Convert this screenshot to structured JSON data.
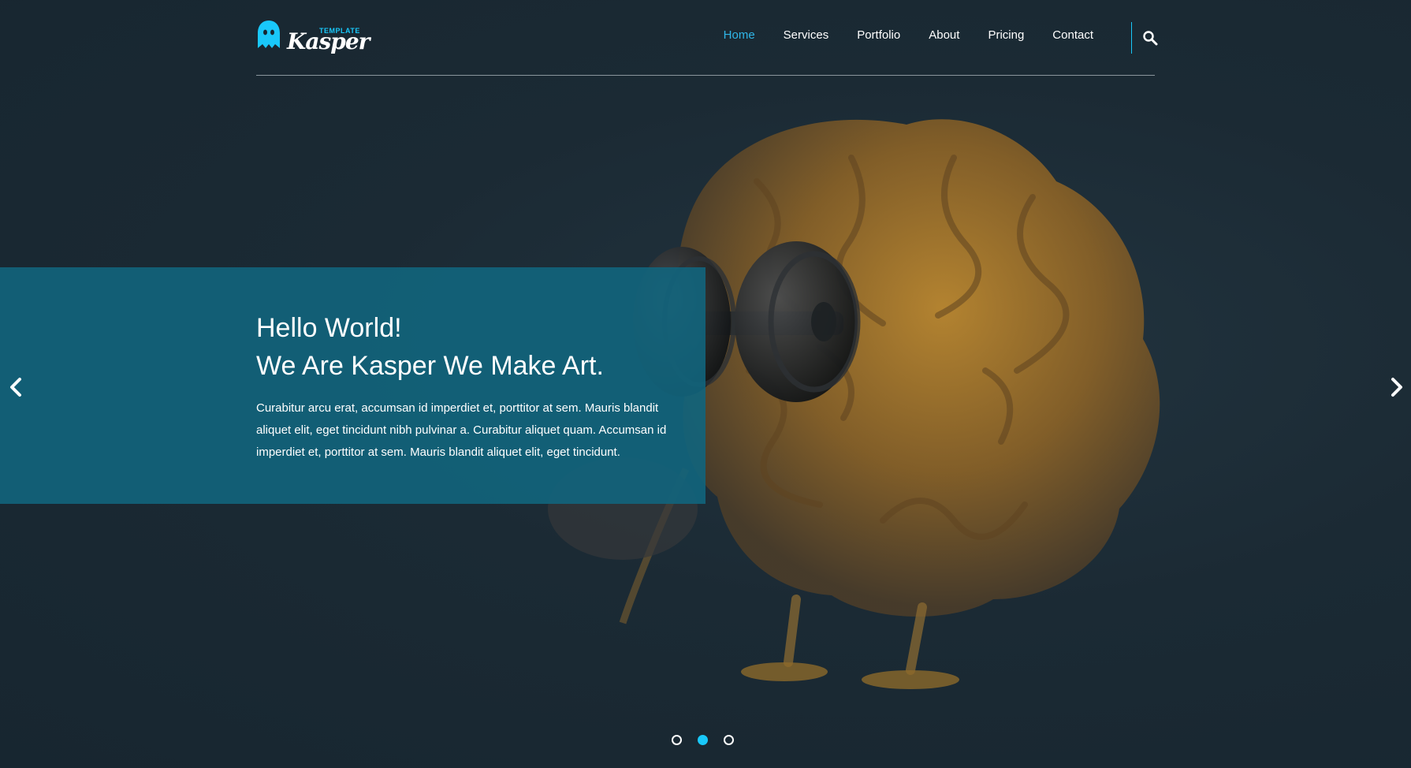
{
  "brand": {
    "logo_word": "Kasper",
    "logo_badge": "TEMPLATE",
    "accent_color": "#19c8fa"
  },
  "nav": {
    "items": [
      {
        "label": "Home",
        "active": true
      },
      {
        "label": "Services",
        "active": false
      },
      {
        "label": "Portfolio",
        "active": false
      },
      {
        "label": "About",
        "active": false
      },
      {
        "label": "Pricing",
        "active": false
      },
      {
        "label": "Contact",
        "active": false
      }
    ],
    "search_icon": "search-icon"
  },
  "hero": {
    "title_line_1": "Hello World!",
    "title_line_2": "We Are Kasper We Make Art.",
    "body": "Curabitur arcu erat, accumsan id imperdiet et, porttitor at sem. Mauris blandit aliquet elit, eget tincidunt nibh pulvinar a. Curabitur aliquet quam. Accumsan id imperdiet et, porttitor at sem. Mauris blandit aliquet elit, eget tincidunt.",
    "caption_bg": "#12647c"
  },
  "carousel": {
    "prev_icon": "chevron-left-icon",
    "next_icon": "chevron-right-icon",
    "slides": 3,
    "active_slide": 2
  }
}
